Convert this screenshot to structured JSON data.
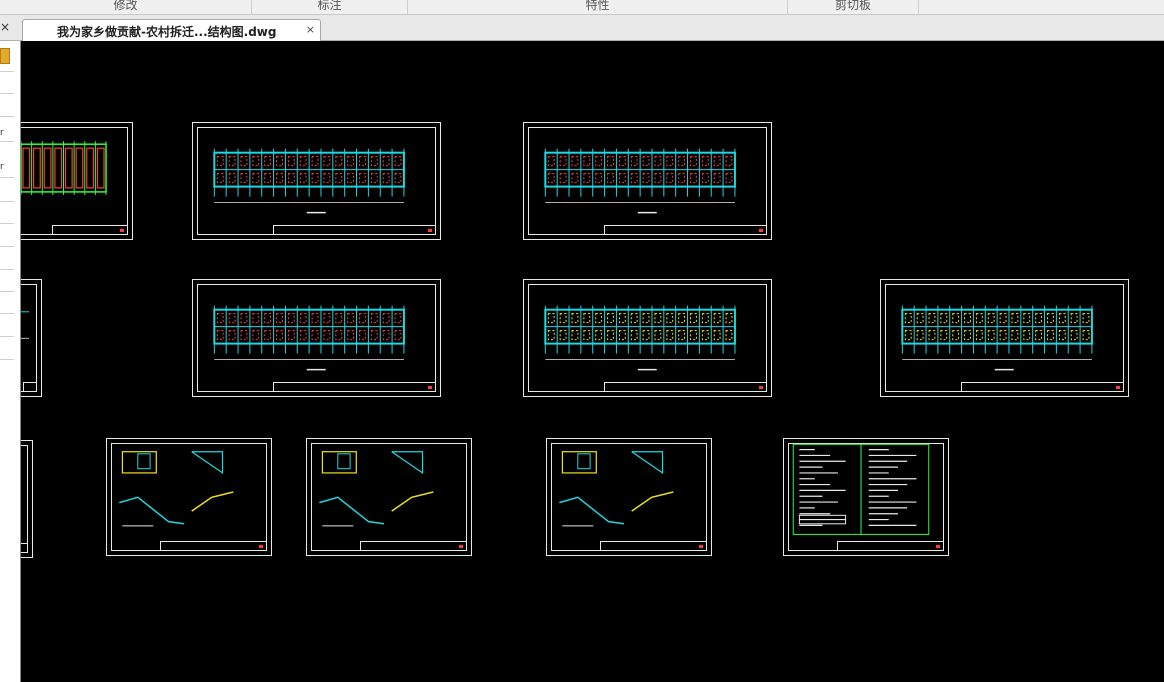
{
  "ribbon": {
    "groups": [
      {
        "id": "modify",
        "label": "修改"
      },
      {
        "id": "annotate",
        "label": "标注"
      },
      {
        "id": "properties",
        "label": "特性"
      },
      {
        "id": "clipboard",
        "label": "剪切板"
      }
    ]
  },
  "panel": {
    "close_label": "×"
  },
  "document_tab": {
    "title": "我为家乡做贡献-农村拆迁...结构图.dwg",
    "close_label": "×"
  },
  "sidebar": {
    "row_labels": [
      "r",
      "r"
    ]
  },
  "colors": {
    "background": "#000000",
    "frame": "#e8e8e8",
    "structure_cyan": "#20d8e0",
    "detail_red": "#ff3b3b",
    "column_yellow": "#f0e020",
    "grid_green": "#30ff30"
  },
  "drawing_sheets": [
    {
      "id": "sheet-floorplan-1",
      "kind": "floor-plan"
    },
    {
      "id": "sheet-structure-plan-1",
      "kind": "structure-plan"
    },
    {
      "id": "sheet-structure-plan-2",
      "kind": "structure-plan"
    },
    {
      "id": "sheet-partial-2",
      "kind": "partial"
    },
    {
      "id": "sheet-structure-plan-3",
      "kind": "structure-plan"
    },
    {
      "id": "sheet-beam-plan-1",
      "kind": "beam-plan"
    },
    {
      "id": "sheet-beam-plan-2",
      "kind": "beam-plan"
    },
    {
      "id": "sheet-partial-3",
      "kind": "partial"
    },
    {
      "id": "sheet-stair-detail-1",
      "kind": "stair-detail"
    },
    {
      "id": "sheet-stair-detail-2",
      "kind": "stair-detail"
    },
    {
      "id": "sheet-stair-detail-3",
      "kind": "stair-detail"
    },
    {
      "id": "sheet-general-notes",
      "kind": "notes"
    }
  ]
}
